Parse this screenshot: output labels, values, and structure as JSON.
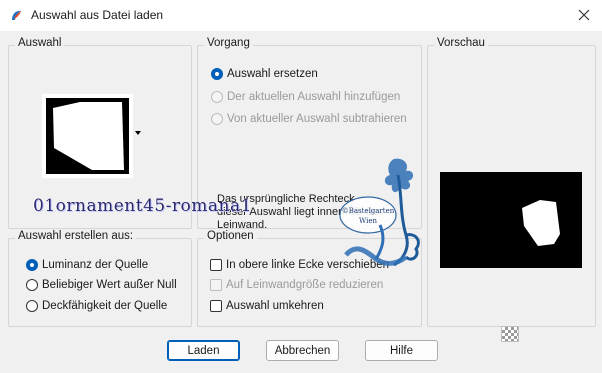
{
  "window": {
    "title": "Auswahl aus Datei laden",
    "close_icon": "close-icon",
    "app_icon": "paintshop-icon"
  },
  "auswahl": {
    "title": "Auswahl"
  },
  "vorgang": {
    "title": "Vorgang",
    "options": [
      {
        "label": "Auswahl ersetzen",
        "selected": true,
        "enabled": true
      },
      {
        "label": "Der aktuellen Auswahl hinzufügen",
        "selected": false,
        "enabled": false
      },
      {
        "label": "Von aktueller Auswahl subtrahieren",
        "selected": false,
        "enabled": false
      }
    ],
    "note": "Das ursprüngliche Rechteck dieser Auswahl liegt innerhalb der Leinwand."
  },
  "vorschau": {
    "title": "Vorschau"
  },
  "erstellen": {
    "title": "Auswahl erstellen aus:",
    "options": [
      {
        "label": "Luminanz der Quelle",
        "selected": true
      },
      {
        "label": "Beliebiger Wert außer Null",
        "selected": false
      },
      {
        "label": "Deckfähigkeit der Quelle",
        "selected": false
      }
    ]
  },
  "optionen": {
    "title": "Optionen",
    "checks": [
      {
        "label": "In obere linke Ecke verschieben",
        "checked": false,
        "enabled": true
      },
      {
        "label": "Auf Leinwandgröße reduzieren",
        "checked": false,
        "enabled": false
      },
      {
        "label": "Auswahl umkehren",
        "checked": false,
        "enabled": true
      }
    ]
  },
  "buttons": {
    "load": "Laden",
    "cancel": "Abbrechen",
    "help": "Hilfe"
  },
  "watermark": {
    "text": "01ornament45-romana1",
    "stamp_line1": "©Bastelgarten",
    "stamp_line2": "Wien"
  },
  "colors": {
    "accent": "#005fb8",
    "preview_bg": "#000000",
    "shape": "#ffffff"
  }
}
